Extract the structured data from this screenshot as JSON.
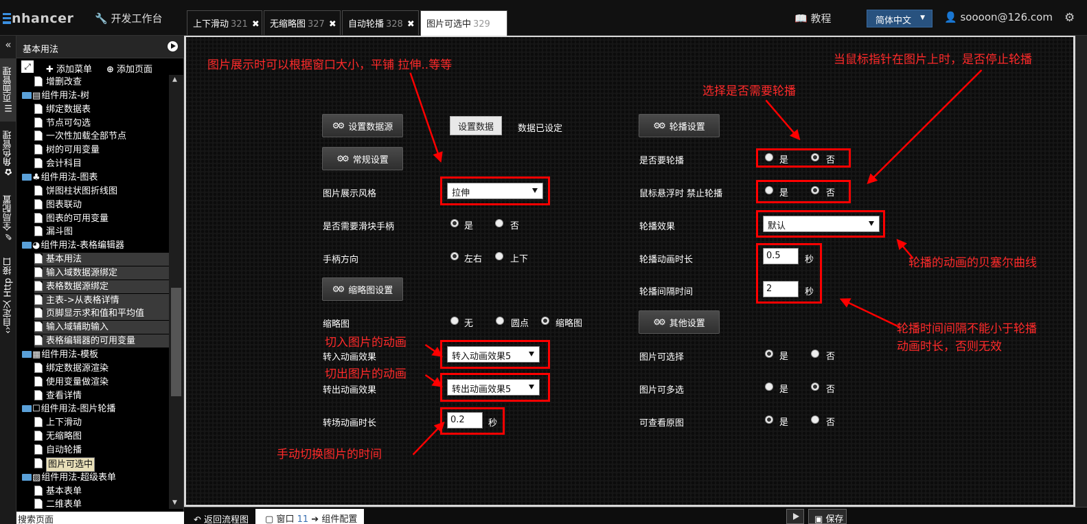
{
  "app": {
    "logo_text": "nhancer",
    "devtools_label": "开发工作台",
    "tutorial_label": "教程",
    "language": "简体中文",
    "user_email": "soooon@126.com"
  },
  "tabs": [
    {
      "label": "上下滑动",
      "num": "321"
    },
    {
      "label": "无缩略图",
      "num": "327"
    },
    {
      "label": "自动轮播",
      "num": "328"
    },
    {
      "label": "图片可选中",
      "num": "329"
    }
  ],
  "vtabs": [
    "页面管理",
    "角色管理",
    "全局配置",
    "自定义 Http 接口"
  ],
  "sidebar": {
    "title": "基本用法",
    "add_menu": "添加菜单",
    "add_page": "添加页面",
    "tree": [
      {
        "label": "增删改查",
        "kind": "page"
      },
      {
        "label": "组件用法-树",
        "kind": "folder"
      },
      {
        "label": "绑定数据表",
        "kind": "page"
      },
      {
        "label": "节点可勾选",
        "kind": "page"
      },
      {
        "label": "一次性加载全部节点",
        "kind": "page"
      },
      {
        "label": "树的可用变量",
        "kind": "page"
      },
      {
        "label": "会计科目",
        "kind": "page"
      },
      {
        "label": "组件用法-图表",
        "kind": "folder"
      },
      {
        "label": "饼图柱状图折线图",
        "kind": "page"
      },
      {
        "label": "图表联动",
        "kind": "page"
      },
      {
        "label": "图表的可用变量",
        "kind": "page"
      },
      {
        "label": "漏斗图",
        "kind": "page"
      },
      {
        "label": "组件用法-表格编辑器",
        "kind": "folder"
      },
      {
        "label": "基本用法",
        "kind": "page"
      },
      {
        "label": "输入域数据源绑定",
        "kind": "page"
      },
      {
        "label": "表格数据源绑定",
        "kind": "page"
      },
      {
        "label": "主表->从表格详情",
        "kind": "page"
      },
      {
        "label": "页脚显示求和值和平均值",
        "kind": "page"
      },
      {
        "label": "输入域辅助输入",
        "kind": "page"
      },
      {
        "label": "表格编辑器的可用变量",
        "kind": "page"
      },
      {
        "label": "组件用法-模板",
        "kind": "folder"
      },
      {
        "label": "绑定数据源渲染",
        "kind": "page"
      },
      {
        "label": "使用变量做渲染",
        "kind": "page"
      },
      {
        "label": "查看详情",
        "kind": "page"
      },
      {
        "label": "组件用法-图片轮播",
        "kind": "folder"
      },
      {
        "label": "上下滑动",
        "kind": "page"
      },
      {
        "label": "无缩略图",
        "kind": "page"
      },
      {
        "label": "自动轮播",
        "kind": "page"
      },
      {
        "label": "图片可选中",
        "kind": "page"
      },
      {
        "label": "组件用法-超级表单",
        "kind": "folder"
      },
      {
        "label": "基本表单",
        "kind": "page"
      },
      {
        "label": "二维表单",
        "kind": "page"
      }
    ],
    "bottom_text": "搜索页面"
  },
  "form": {
    "btn_set_datasource": "设置数据源",
    "btn_set_data": "设置数据",
    "data_status": "数据已设定",
    "btn_general": "常规设置",
    "display_style_label": "图片展示风格",
    "display_style_value": "拉伸",
    "slider_handle_label": "是否需要滑块手柄",
    "handle_dir_label": "手柄方向",
    "handle_left_right": "左右",
    "handle_up_down": "上下",
    "btn_thumb": "缩略图设置",
    "thumb_label": "缩略图",
    "thumb_none": "无",
    "thumb_dot": "圆点",
    "thumb_pic": "缩略图",
    "anim_in_label": "转入动画效果",
    "anim_in_value": "转入动画效果5",
    "anim_out_label": "转出动画效果",
    "anim_out_value": "转出动画效果5",
    "transition_label": "转场动画时长",
    "transition_value": "0.2",
    "sec": "秒",
    "yes": "是",
    "no": "否",
    "btn_carousel": "轮播设置",
    "autoplay_label": "是否要轮播",
    "hover_stop_label": "鼠标悬浮时 禁止轮播",
    "effect_label": "轮播效果",
    "effect_value": "默认",
    "anim_duration_label": "轮播动画时长",
    "anim_duration_value": "0.5",
    "interval_label": "轮播间隔时间",
    "interval_value": "2",
    "btn_other": "其他设置",
    "selectable_label": "图片可选择",
    "multi_label": "图片可多选",
    "view_orig_label": "可查看原图"
  },
  "annotations": {
    "display_note": "图片展示时可以根据窗口大小，平铺  拉伸..等等",
    "autoplay_note": "选择是否需要轮播",
    "hover_note": "当鼠标指针在图片上时，是否停止轮播",
    "bezier_note": "轮播的动画的贝塞尔曲线",
    "interval_note_1": "轮播时间间隔不能小于轮播",
    "interval_note_2": "动画时长，否则无效",
    "in_note": "切入图片的动画",
    "out_note": "切出图片的动画",
    "manual_note": "手动切换图片的时间"
  },
  "bottom": {
    "back_label": "返回流程图",
    "window_label": "窗口",
    "window_num": "11",
    "component_label": "组件配置",
    "save_label": "保存"
  },
  "colors": {
    "annotation": "#ff0000",
    "lang_bg": "#28527f",
    "folder": "#5aa0d8",
    "current_page_bg": "#e8dfb8"
  }
}
